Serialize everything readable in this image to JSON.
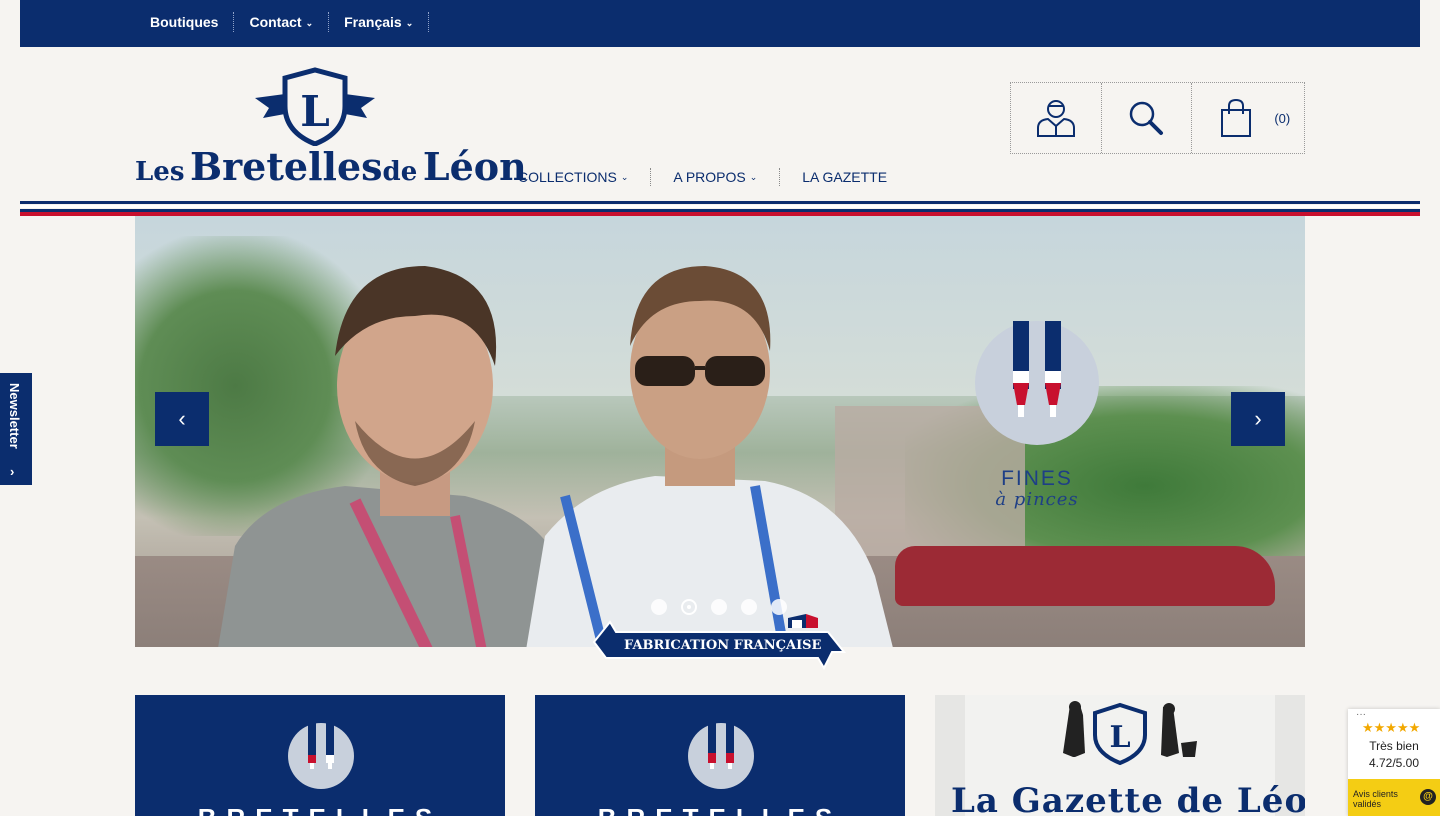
{
  "topnav": {
    "items": [
      {
        "label": "Boutiques",
        "has_dropdown": false
      },
      {
        "label": "Contact",
        "has_dropdown": true
      },
      {
        "label": "Français",
        "has_dropdown": true
      }
    ]
  },
  "logo": {
    "small1": "Les",
    "big1": "Bretelles",
    "small2": "de",
    "big2": "Léon",
    "monogram": "L"
  },
  "mainnav": {
    "items": [
      {
        "label": "COLLECTIONS",
        "has_dropdown": true
      },
      {
        "label": "A PROPOS",
        "has_dropdown": true
      },
      {
        "label": "LA GAZETTE",
        "has_dropdown": false
      }
    ]
  },
  "header_icons": {
    "account_icon": "user-icon",
    "search_icon": "search-icon",
    "cart_icon": "shopping-bag-icon",
    "cart_count": "(0)"
  },
  "hero": {
    "overlay_title": "FINES",
    "overlay_subtitle": "à pinces",
    "prev_label": "‹",
    "next_label": "›",
    "slide_count": 5,
    "active_slide": 2,
    "ribbon_text": "FABRICATION FRANÇAISE"
  },
  "newsletter": {
    "label": "Newsletter",
    "arrow": "›"
  },
  "cards": [
    {
      "word": "BRETELLES"
    },
    {
      "word": "BRETELLES"
    },
    {
      "title": "La Gazette de Léon",
      "monogram": "L"
    }
  ],
  "review": {
    "stars": "★★★★★",
    "label": "Très bien",
    "score": "4.72/5.00",
    "footer": "Avis clients validés",
    "badge": "@",
    "more": "···"
  },
  "colors": {
    "navy": "#0b2d6e",
    "red": "#c8102e",
    "background": "#f6f4f1",
    "stars": "#f2a800",
    "review_footer": "#f4cd14"
  }
}
